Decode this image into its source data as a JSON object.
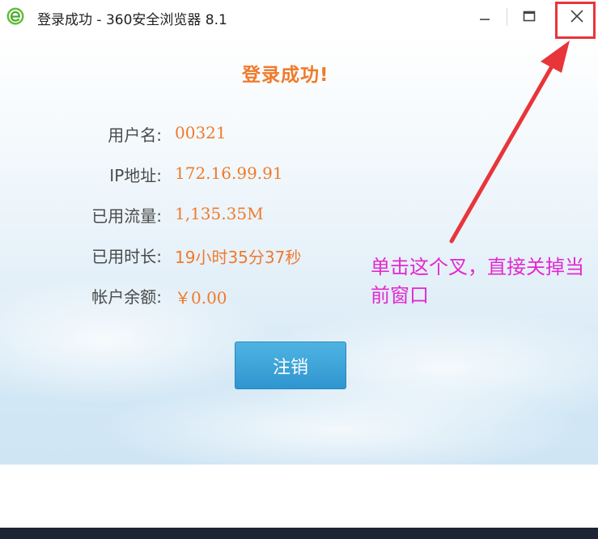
{
  "window": {
    "title": "登录成功 - 360安全浏览器 8.1",
    "app_icon": "360-browser-e-icon",
    "controls": [
      "minimize-icon",
      "maximize-icon",
      "close-icon"
    ]
  },
  "page": {
    "heading": "登录成功!",
    "rows": [
      {
        "label": "用户名:",
        "value": "00321"
      },
      {
        "label": "IP地址:",
        "value": "172.16.99.91"
      },
      {
        "label": "已用流量:",
        "value": "1,135.35M"
      },
      {
        "label": "已用时长:",
        "value": "19小时35分37秒"
      },
      {
        "label": "帐户余额:",
        "value": "￥0.00"
      }
    ],
    "logout_button": "注销"
  },
  "annotation": {
    "text": "单击这个叉，直接关掉当前窗口"
  },
  "colors": {
    "accent_orange": "#f07a2b",
    "button_blue": "#3aa2d8",
    "annotation_magenta": "#e328cf",
    "highlight_red": "#e8353a"
  }
}
